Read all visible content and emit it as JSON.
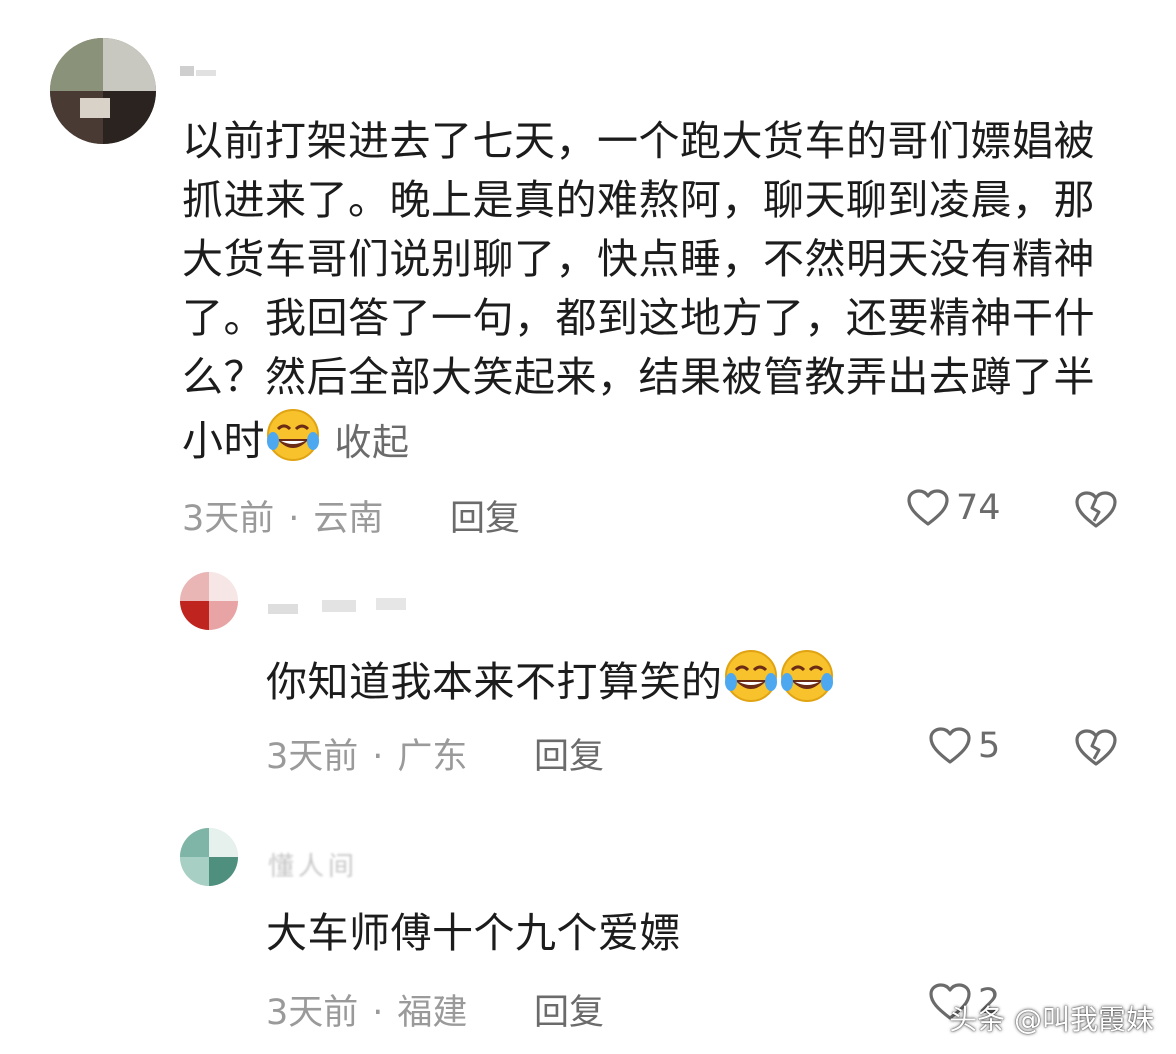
{
  "comments": [
    {
      "text": "以前打架进去了七天，一个跑大货车的哥们嫖娼被抓进来了。晚上是真的难熬阿，聊天聊到凌晨，那大货车哥们说别聊了，快点睡，不然明天没有精神了。我回答了一句，都到这地方了，还要精神干什么？然后全部大笑起来，结果被管教弄出去蹲了半小时",
      "collapse_label": "收起",
      "time": "3天前",
      "location": "云南",
      "reply_label": "回复",
      "likes": "74"
    },
    {
      "text": "你知道我本来不打算笑的",
      "time": "3天前",
      "location": "广东",
      "reply_label": "回复",
      "likes": "5"
    },
    {
      "name_partial": "懂人间",
      "text": "大车师傅十个九个爱嫖",
      "time": "3天前",
      "location": "福建",
      "reply_label": "回复",
      "likes": "2"
    }
  ],
  "separator": "·",
  "watermark": "头条 @叫我霞妹",
  "icons": {
    "like": "heart-outline-icon",
    "dislike": "broken-heart-icon",
    "emoji": "laughing-tears-emoji"
  }
}
